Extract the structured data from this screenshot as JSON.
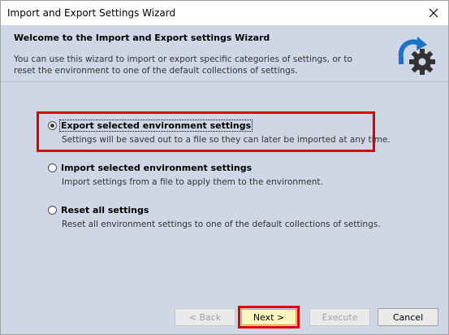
{
  "window": {
    "title": "Import and Export Settings Wizard"
  },
  "header": {
    "title": "Welcome to the Import and Export settings Wizard",
    "description": "You can use this wizard to import or export specific categories of settings, or to reset the environment to one of the default collections of settings."
  },
  "options": [
    {
      "label": "Export selected environment settings",
      "description": "Settings will be saved out to a file so they can later be imported at any time.",
      "selected": true
    },
    {
      "label": "Import selected environment settings",
      "description": "Import settings from a file to apply them to the environment.",
      "selected": false
    },
    {
      "label": "Reset all settings",
      "description": "Reset all environment settings to one of the default collections of settings.",
      "selected": false
    }
  ],
  "buttons": {
    "back": "< Back",
    "next": "Next >",
    "execute": "Execute",
    "cancel": "Cancel"
  },
  "colors": {
    "background": "#cfd6e5",
    "highlight": "#e00000",
    "icon_blue": "#1a73c8",
    "icon_gear": "#333333"
  }
}
